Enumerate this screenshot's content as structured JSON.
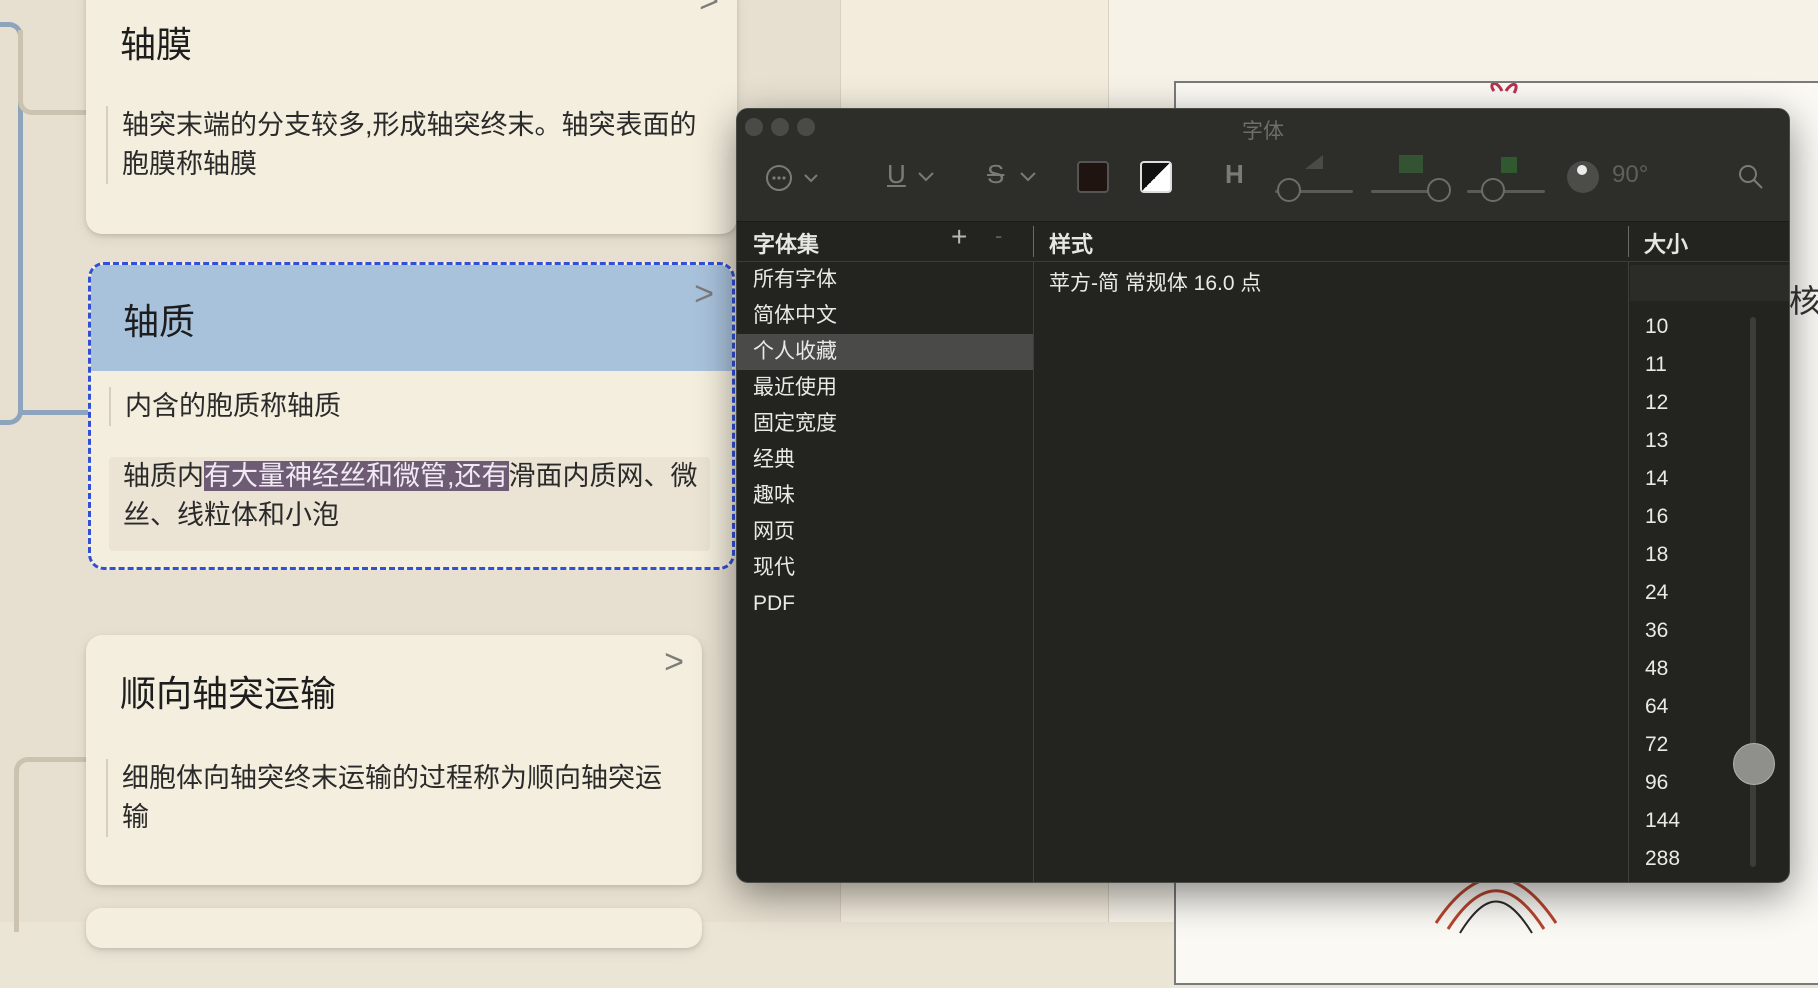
{
  "cards": {
    "axolemma": {
      "title": "轴膜",
      "text": "轴突末端的分支较多,形成轴突终末。轴突表面的胞膜称轴膜"
    },
    "axoplasm": {
      "title": "轴质",
      "text1": "内含的胞质称轴质",
      "text2_before": "轴质内",
      "text2_selected": "有大量神经丝和微管,还有",
      "text2_after": "滑面内质网、微丝、线粒体和小泡"
    },
    "anterograde": {
      "title": "顺向轴突运输",
      "text": "细胞体向轴突终末运输的过程称为顺向轴突运输"
    },
    "arrow": ">"
  },
  "colors": {
    "selected_card_header": "#a9c2dc",
    "selection_highlight": "#6e5c74",
    "selected_card_border": "#3050d8",
    "text_color_swatch": "#1f140f"
  },
  "font_panel": {
    "title": "字体",
    "toolbar": {
      "actions_icon": "⋯",
      "underline": "U",
      "strikethrough": "S",
      "chevron": "⌄",
      "shadow_icon": "H",
      "angle": "90°",
      "search_icon": "magnifier"
    },
    "headers": {
      "collections": "字体集",
      "add": "+",
      "remove": "-",
      "style": "样式",
      "size": "大小"
    },
    "collections": [
      "所有字体",
      "简体中文",
      "个人收藏",
      "最近使用",
      "固定宽度",
      "经典",
      "趣味",
      "网页",
      "现代",
      "PDF"
    ],
    "selected_collection": "个人收藏",
    "styles": [
      "苹方-简 常规体 16.0 点"
    ],
    "size_value": "",
    "sizes": [
      "10",
      "11",
      "12",
      "13",
      "14",
      "16",
      "18",
      "24",
      "36",
      "48",
      "64",
      "72",
      "96",
      "144",
      "288"
    ]
  },
  "canvas_peek": {
    "text": "核"
  }
}
